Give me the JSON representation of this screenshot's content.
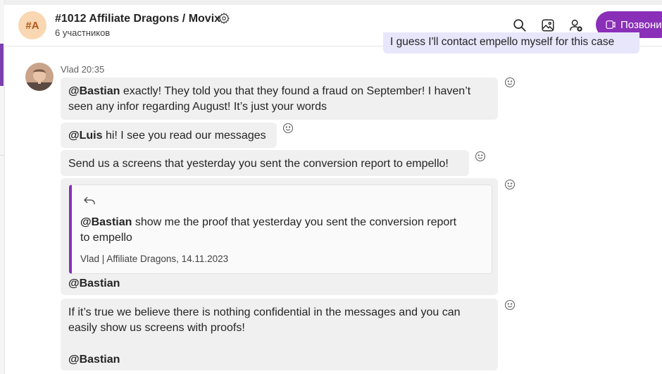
{
  "header": {
    "avatar_initials": "#A",
    "title": "#1012 Affiliate Dragons / Movix",
    "participants": "6 участников",
    "call_label": "Позвонить",
    "icons": [
      "search-icon",
      "image-icon",
      "add-person-icon",
      "gear-icon",
      "video-call-icon"
    ],
    "accent_color": "#8a2fb8"
  },
  "previous_message": {
    "text": "I guess I'll contact empello myself for this case"
  },
  "message": {
    "sender": "Vlad",
    "time": "20:35",
    "bubbles": [
      {
        "mention": "@Bastian",
        "line1": " exactly! They told you that they found a fraud on September! I haven’t",
        "line2": "seen any infor regarding August! It’s just your words"
      },
      {
        "mention": "@Luis",
        "text": " hi! I see you read our messages"
      },
      {
        "text": "Send us a screens that yesterday you sent the conversion report to empello!"
      },
      {
        "quote": {
          "mention": "@Bastian",
          "line1": " show me the proof that yesterday you sent the conversion report",
          "line2": "to empello",
          "source": "Vlad | Affiliate Dragons, 14.11.2023"
        },
        "after_mention": "@Bastian"
      },
      {
        "line1": "If it’s true we believe there is nothing confidential in the messages and you can",
        "line2": "easily show us screens with proofs!",
        "mention_end": "@Bastian"
      }
    ]
  }
}
